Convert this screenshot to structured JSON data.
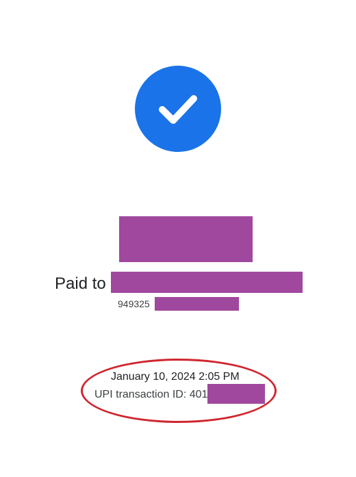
{
  "status": {
    "icon": "check-icon",
    "color": "#1a73e8"
  },
  "payment": {
    "paid_to_label": "Paid to",
    "phone_prefix": "949325"
  },
  "details": {
    "datetime": "January 10, 2024 2:05 PM",
    "txn_label": "UPI transaction ID: 401"
  },
  "colors": {
    "redaction": "#a0489e",
    "annotation": "#d0262f"
  }
}
